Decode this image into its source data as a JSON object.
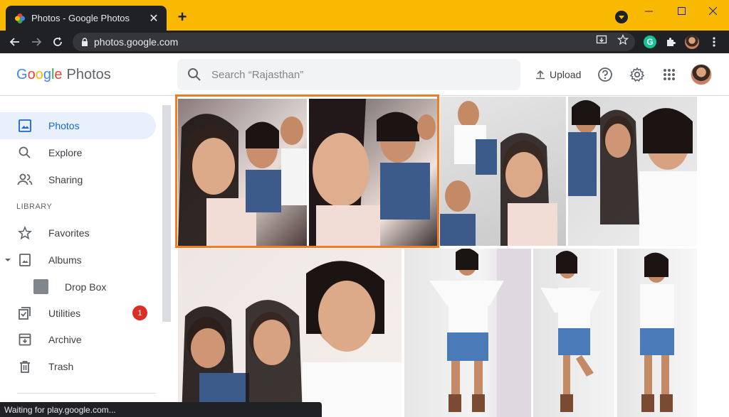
{
  "browser": {
    "tab_title": "Photos - Google Photos",
    "url": "photos.google.com",
    "status_text": "Waiting for play.google.com..."
  },
  "header": {
    "logo_letters": [
      {
        "ch": "G",
        "color": "#4285f4"
      },
      {
        "ch": "o",
        "color": "#ea4335"
      },
      {
        "ch": "o",
        "color": "#fbbc05"
      },
      {
        "ch": "g",
        "color": "#4285f4"
      },
      {
        "ch": "l",
        "color": "#34a853"
      },
      {
        "ch": "e",
        "color": "#ea4335"
      }
    ],
    "product": "Photos",
    "search_placeholder": "Search “Rajasthan”",
    "upload_label": "Upload"
  },
  "sidebar": {
    "items": [
      {
        "label": "Photos",
        "icon": "photo-icon",
        "active": true
      },
      {
        "label": "Explore",
        "icon": "search-icon"
      },
      {
        "label": "Sharing",
        "icon": "people-icon"
      }
    ],
    "library_label": "LIBRARY",
    "library_items": [
      {
        "label": "Favorites",
        "icon": "star-icon"
      },
      {
        "label": "Albums",
        "icon": "album-icon"
      },
      {
        "label": "Drop Box",
        "icon": "album-thumbnail"
      },
      {
        "label": "Utilities",
        "icon": "utilities-icon",
        "badge": "1"
      },
      {
        "label": "Archive",
        "icon": "archive-icon"
      },
      {
        "label": "Trash",
        "icon": "trash-icon"
      }
    ]
  },
  "colors": {
    "accent": "#1967d2",
    "selection": "#f07c24",
    "badge": "#d93025",
    "titlebar": "#f9b900"
  }
}
